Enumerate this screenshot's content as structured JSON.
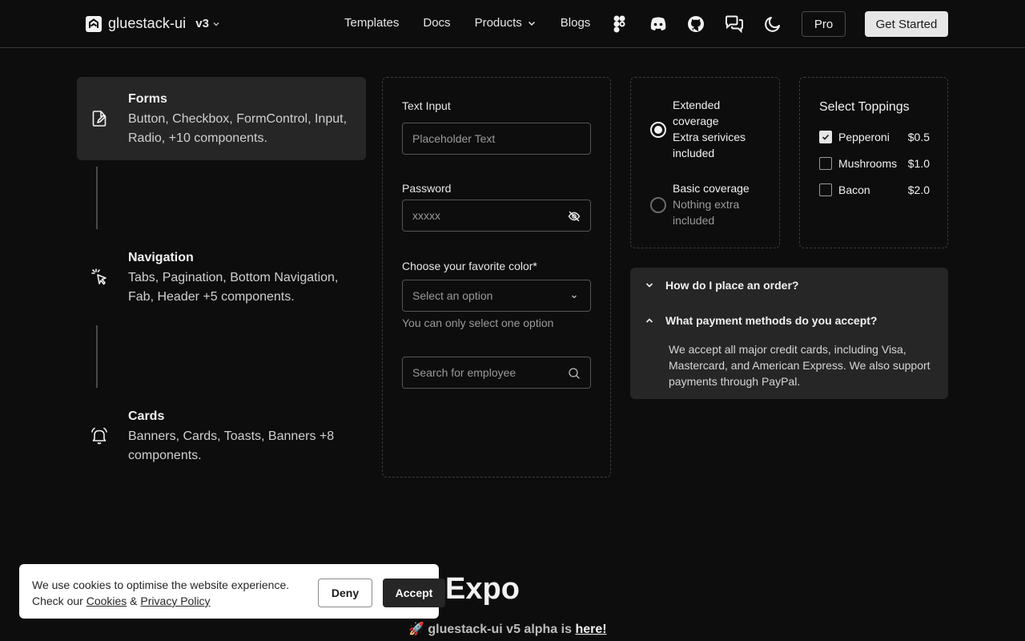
{
  "header": {
    "logo_text": "gluestack-ui",
    "version": "v3",
    "nav": [
      "Templates",
      "Docs",
      "Products",
      "Blogs"
    ],
    "pro_label": "Pro",
    "get_started_label": "Get Started",
    "icons": [
      "figma-icon",
      "discord-icon",
      "github-icon",
      "chat-icon",
      "moon-icon"
    ]
  },
  "categories": [
    {
      "title": "Forms",
      "desc": "Button, Checkbox, FormControl, Input, Radio, +10 components.",
      "icon": "form-edit-icon"
    },
    {
      "title": "Navigation",
      "desc": "Tabs, Pagination, Bottom Navigation, Fab, Header +5 components.",
      "icon": "pointer-click-icon"
    },
    {
      "title": "Cards",
      "desc": "Banners, Cards, Toasts, Banners +8 components.",
      "icon": "bell-icon"
    }
  ],
  "form": {
    "text_input_label": "Text Input",
    "text_input_placeholder": "Placeholder Text",
    "password_label": "Password",
    "password_value": "xxxxx",
    "color_label": "Choose your favorite color",
    "required_mark": "*",
    "select_placeholder": "Select an option",
    "select_helper": "You can only select one option",
    "search_placeholder": "Search for employee"
  },
  "coverage": [
    {
      "title": "Extended coverage",
      "sub": "Extra serivices included",
      "selected": true
    },
    {
      "title": "Basic coverage",
      "sub": "Nothing extra included",
      "selected": false
    }
  ],
  "toppings": {
    "title": "Select Toppings",
    "items": [
      {
        "name": "Pepperoni",
        "price": "$0.5",
        "checked": true
      },
      {
        "name": "Mushrooms",
        "price": "$1.0",
        "checked": false
      },
      {
        "name": "Bacon",
        "price": "$2.0",
        "checked": false
      }
    ]
  },
  "faq": {
    "q1": "How do I place an order?",
    "q2": "What payment methods do you accept?",
    "a2": "We accept all major credit cards, including Visa, Mastercard, and American Express. We also support payments through PayPal."
  },
  "bottom": {
    "heading": "Expo",
    "banner_prefix": "🚀 gluestack-ui v5 alpha is ",
    "banner_link": "here!"
  },
  "cookie": {
    "text_1": "We use cookies to optimise the website experience. Check our ",
    "cookies_link": "Cookies",
    "amp": " & ",
    "privacy_link": "Privacy Policy",
    "deny_label": "Deny",
    "accept_label": "Accept"
  }
}
